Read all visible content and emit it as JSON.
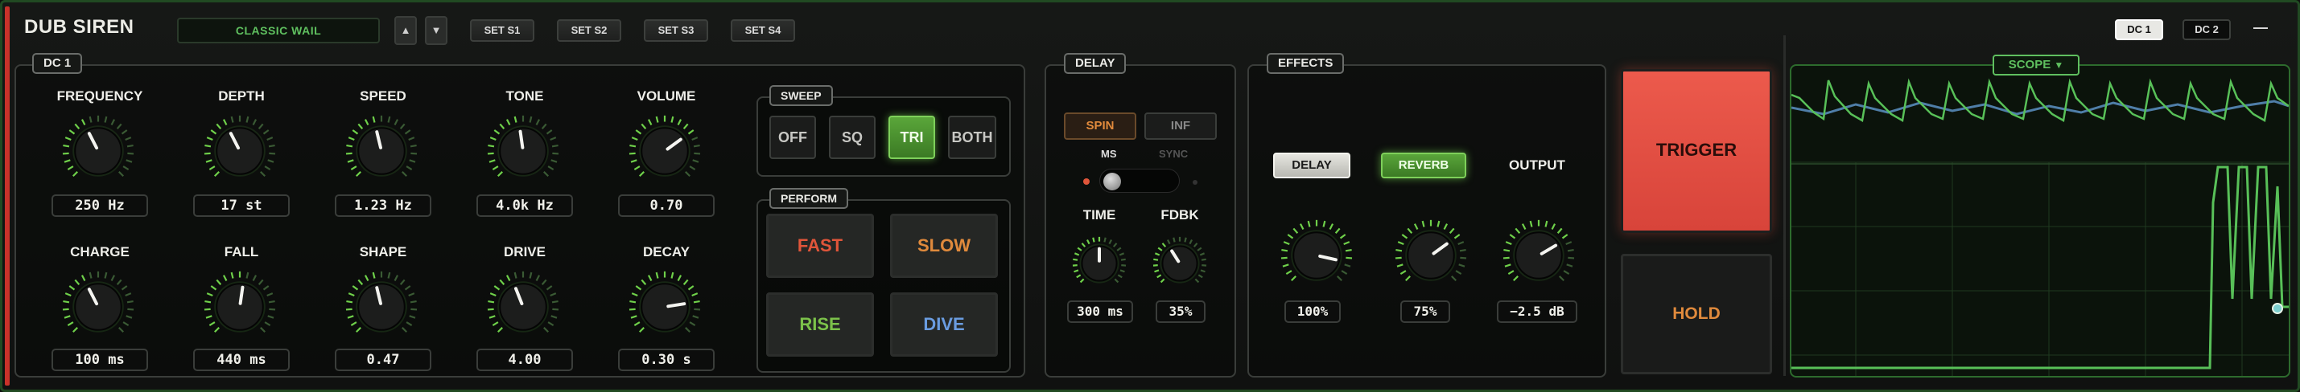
{
  "header": {
    "title": "DUB SIREN",
    "preset": "CLASSIC WAIL",
    "up_icon": "▲",
    "down_icon": "▼",
    "sets": [
      "SET S1",
      "SET S2",
      "SET S3",
      "SET S4"
    ],
    "dc_tabs": [
      "DC 1",
      "DC 2"
    ],
    "minimize": "—"
  },
  "dc_panel": {
    "tab": "DC 1",
    "knobs_row1": [
      {
        "label": "FREQUENCY",
        "value": "250 Hz",
        "level": 0.4
      },
      {
        "label": "DEPTH",
        "value": "17 st",
        "level": 0.4
      },
      {
        "label": "SPEED",
        "value": "1.23 Hz",
        "level": 0.45
      },
      {
        "label": "TONE",
        "value": "4.0k Hz",
        "level": 0.47
      },
      {
        "label": "VOLUME",
        "value": "0.70",
        "level": 0.7
      }
    ],
    "knobs_row2": [
      {
        "label": "CHARGE",
        "value": "100 ms",
        "level": 0.4
      },
      {
        "label": "FALL",
        "value": "440 ms",
        "level": 0.53
      },
      {
        "label": "SHAPE",
        "value": "0.47",
        "level": 0.45
      },
      {
        "label": "DRIVE",
        "value": "4.00",
        "level": 0.42
      },
      {
        "label": "DECAY",
        "value": "0.30 s",
        "level": 0.8
      }
    ]
  },
  "sweep": {
    "tab": "SWEEP",
    "options": [
      "OFF",
      "SQ",
      "TRI",
      "BOTH"
    ],
    "selected": "TRI"
  },
  "perform": {
    "tab": "PERFORM",
    "buttons": [
      {
        "label": "FAST",
        "color": "#e0553a"
      },
      {
        "label": "SLOW",
        "color": "#e08a3c"
      },
      {
        "label": "RISE",
        "color": "#7cc24a"
      },
      {
        "label": "DIVE",
        "color": "#6a9ce0"
      }
    ]
  },
  "delay": {
    "tab": "DELAY",
    "spin": "SPIN",
    "inf": "INF",
    "ms": "MS",
    "sync": "SYNC",
    "time_label": "TIME",
    "time_value": "300 ms",
    "time_level": 0.5,
    "fdbk_label": "FDBK",
    "fdbk_value": "35%",
    "fdbk_level": 0.38
  },
  "effects": {
    "tab": "EFFECTS",
    "delay_btn": "DELAY",
    "reverb_btn": "REVERB",
    "output_label": "OUTPUT",
    "knobs": [
      {
        "value": "100%",
        "level": 0.88
      },
      {
        "value": "75%",
        "level": 0.7
      },
      {
        "value": "−2.5 dB",
        "level": 0.72
      }
    ]
  },
  "trigger": {
    "label": "TRIGGER",
    "color": "#e25044"
  },
  "hold": {
    "label": "HOLD",
    "color": "#e08a3c"
  },
  "scope": {
    "tab": "SCOPE",
    "chevron": "▼"
  },
  "colors": {
    "accent_green": "#5fc05f",
    "trigger_red": "#e25044",
    "blue_wave": "#4f7ea8"
  }
}
